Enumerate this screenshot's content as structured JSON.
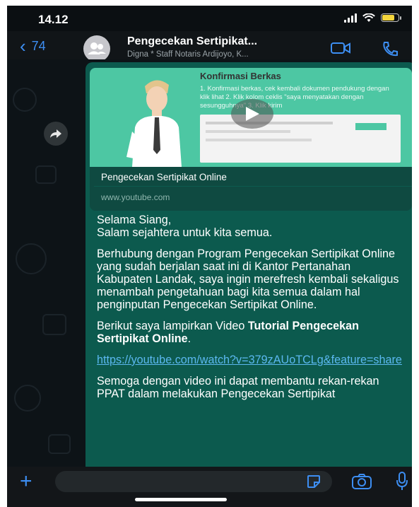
{
  "status_bar": {
    "time": "14.12",
    "battery_level": 0.75,
    "battery_color": "#f5d63d"
  },
  "header": {
    "back_count": "74",
    "title": "Pengecekan Sertipikat...",
    "subtitle": "Digna * Staff Notaris Ardijoyo, K...",
    "accent": "#3d8ef2"
  },
  "link_preview": {
    "thumb_title": "Konfirmasi Berkas",
    "thumb_text": "1. Konfirmasi berkas, cek kembali dokumen pendukung dengan klik lihat 2. Klik kolom ceklis \"saya menyatakan dengan sesungguhnya\" 3. Klik kirim",
    "title": "Pengecekan Sertipikat Online",
    "domain": "www.youtube.com"
  },
  "message": {
    "p1_line1": "Selama Siang,",
    "p1_line2": "Salam sejahtera untuk kita semua.",
    "p2": "Berhubung dengan Program Pengecekan Sertipikat Online yang sudah berjalan saat ini di Kantor Pertanahan Kabupaten Landak, saya ingin merefresh kembali sekaligus menambah pengetahuan bagi kita semua dalam hal penginputan Pengecekan Sertipikat Online.",
    "p3_prefix": "Berikut saya lampirkan Video ",
    "p3_bold": "Tutorial Pengecekan Sertipikat Online",
    "p3_suffix": ".",
    "link": "https://youtube.com/watch?v=379zAUoTCLg&feature=share",
    "p4": "Semoga dengan video ini dapat membantu rekan-rekan PPAT dalam melakukan Pengecekan Sertipikat"
  },
  "icons": {
    "back": "chevron-left-icon",
    "video_call": "video-camera-icon",
    "call": "phone-icon",
    "forward": "forward-icon",
    "play": "play-icon",
    "add": "plus-icon",
    "sticker": "sticker-icon",
    "camera": "camera-icon",
    "mic": "microphone-icon"
  },
  "colors": {
    "bubble": "#0c5a4e",
    "link": "#5bb8f0"
  }
}
